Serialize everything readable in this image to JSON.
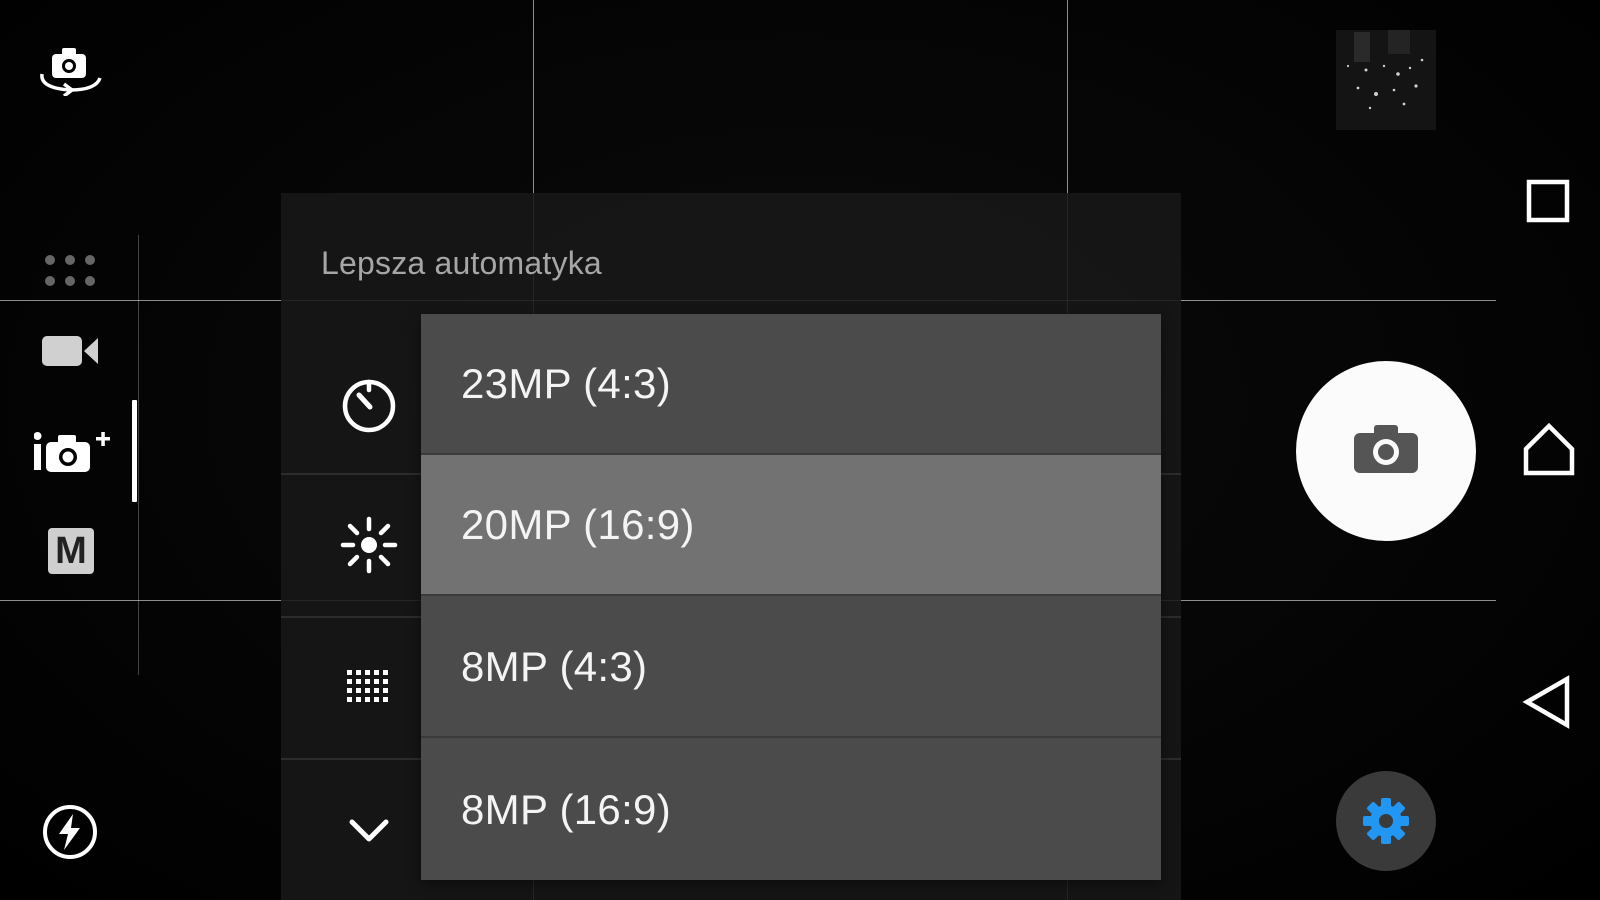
{
  "settings_panel": {
    "title": "Lepsza automatyka",
    "rows": [
      {
        "icon": "self-timer-icon"
      },
      {
        "icon": "brightness-icon"
      },
      {
        "icon": "resolution-grid-icon"
      },
      {
        "icon": "chevron-down-icon"
      }
    ]
  },
  "resolution_menu": {
    "options": [
      {
        "label": "23MP (4:3)",
        "selected": false
      },
      {
        "label": "20MP (16:9)",
        "selected": true
      },
      {
        "label": "8MP (4:3)",
        "selected": false
      },
      {
        "label": "8MP (16:9)",
        "selected": false
      }
    ]
  },
  "left_rail": {
    "icons": [
      "switch-camera-icon",
      "more-modes-icon",
      "video-mode-icon",
      "superior-auto-icon",
      "manual-mode-icon",
      "flash-auto-icon"
    ],
    "manual_label": "M",
    "active_mode": "superior-auto-icon"
  },
  "right_rail": {
    "icons": [
      "gallery-thumbnail",
      "shutter-camera-icon",
      "settings-gear-icon"
    ],
    "settings_accent": "#2196f3"
  },
  "nav_bar": {
    "icons": [
      "recents-icon",
      "home-icon",
      "back-icon"
    ]
  }
}
